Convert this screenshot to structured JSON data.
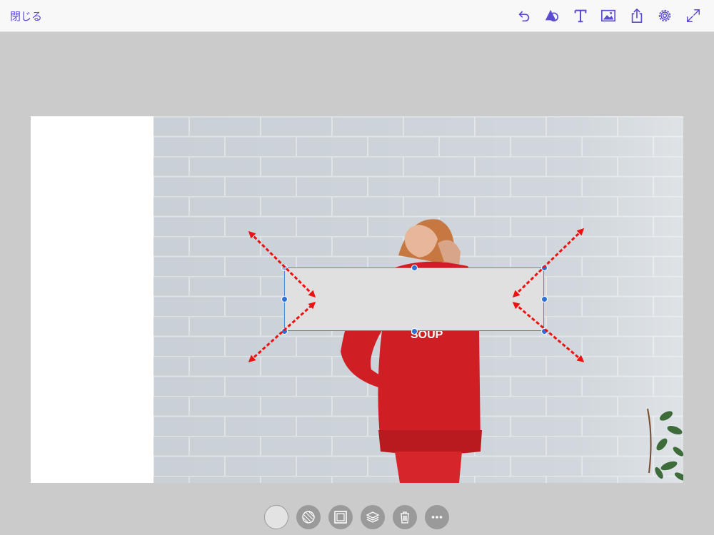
{
  "header": {
    "close_label": "閉じる",
    "tools": [
      "undo-icon",
      "shapes-icon",
      "text-icon",
      "image-icon",
      "share-icon",
      "settings-icon",
      "fullscreen-icon"
    ]
  },
  "canvas": {
    "shirt_text": "SOUP",
    "fill_color": "#e0e0e0",
    "accent_color": "#5a4bd0",
    "selection_color": "#2f6fd6"
  },
  "bottom_toolbar": {
    "buttons": [
      "color-swatch-button",
      "opacity-button",
      "border-button",
      "layers-button",
      "delete-button",
      "more-button"
    ]
  }
}
